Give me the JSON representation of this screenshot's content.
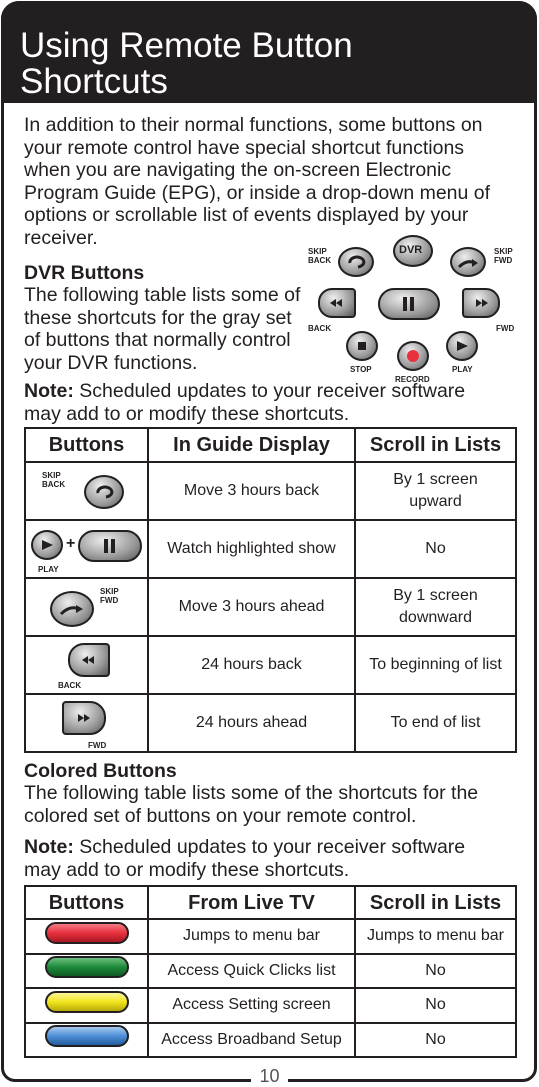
{
  "title": "Using Remote Button Shortcuts",
  "intro": "In addition to their normal functions, some buttons on your remote control have special shortcut functions when you are navigating the on-screen Electronic Program Guide (EPG), or inside a drop-down menu of options or scrollable list of events displayed by your receiver.",
  "dvr": {
    "heading": "DVR Buttons",
    "text": "The following table lists some of these shortcuts for the gray set of buttons that normally control your DVR functions.",
    "note_label": "Note:",
    "note": " Scheduled updates to your receiver software may add to or modify these shortcuts.",
    "remote_labels": {
      "skip_back": "SKIP BACK",
      "dvr": "DVR",
      "skip_fwd": "SKIP FWD",
      "back": "BACK",
      "fwd": "FWD",
      "stop": "STOP",
      "record": "RECORD",
      "play": "PLAY"
    },
    "headers": [
      "Buttons",
      "In Guide Display",
      "Scroll in Lists"
    ],
    "rows": [
      {
        "button": "SKIP BACK",
        "icon": "skip-back-icon",
        "guide": "Move 3 hours back",
        "lists": "By 1 screen upward"
      },
      {
        "button": "PLAY + PAUSE",
        "label": "PLAY",
        "plus": "+",
        "icon": "play-pause-icon",
        "guide": "Watch highlighted show",
        "lists": "No"
      },
      {
        "button": "SKIP FWD",
        "icon": "skip-fwd-icon",
        "guide": "Move 3 hours ahead",
        "lists": "By 1 screen downward"
      },
      {
        "button": "BACK",
        "icon": "rewind-icon",
        "guide": "24 hours back",
        "lists": "To beginning of list"
      },
      {
        "button": "FWD",
        "icon": "fast-forward-icon",
        "guide": "24 hours ahead",
        "lists": "To end of list"
      }
    ]
  },
  "colored": {
    "heading": "Colored Buttons",
    "text": "The following table lists some of the shortcuts for the colored set of buttons on your remote control.",
    "note_label": "Note:",
    "note": " Scheduled updates to your receiver software may add to or modify these shortcuts.",
    "headers": [
      "Buttons",
      "From Live TV",
      "Scroll in Lists"
    ],
    "rows": [
      {
        "color": "#e8303e",
        "live": "Jumps to menu bar",
        "lists": "Jumps to menu bar"
      },
      {
        "color": "#1e8a3a",
        "live": "Access Quick Clicks list",
        "lists": "No"
      },
      {
        "color": "#f2e51c",
        "live": "Access Setting screen",
        "lists": "No"
      },
      {
        "color": "#4d8fd6",
        "live": "Access Broadband Setup",
        "lists": "No"
      }
    ]
  },
  "page_number": "10"
}
